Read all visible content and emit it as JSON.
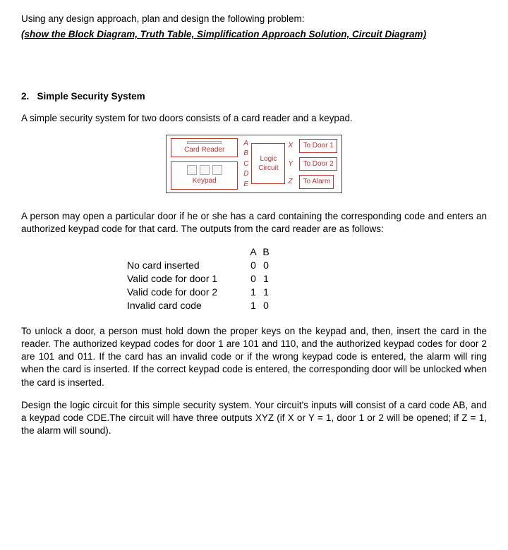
{
  "intro": {
    "line1": "Using any design approach,  plan and design the following problem:",
    "line2": "(show the Block Diagram, Truth Table, Simplification Approach Solution, Circuit Diagram)"
  },
  "section": {
    "number": "2.",
    "title": "Simple Security System",
    "intro": "A simple security system for two doors consists of a card reader and a keypad."
  },
  "block_diagram": {
    "card_reader": "Card Reader",
    "keypad": "Keypad",
    "signals_in": [
      "A",
      "B",
      "C",
      "D",
      "E"
    ],
    "logic_box_l1": "Logic",
    "logic_box_l2": "Circuit",
    "signals_out": [
      "X",
      "Y",
      "Z"
    ],
    "out_labels": [
      "To Door 1",
      "To Door 2",
      "To Alarm"
    ]
  },
  "para_after_diagram": "A person may open a particular door if he or she has a card containing the corresponding code and enters an authorized keypad code for that card. The outputs from the card reader are as follows:",
  "truth_table": {
    "header_a": "A",
    "header_b": "B",
    "rows": [
      {
        "label": "No card inserted",
        "a": "0",
        "b": "0"
      },
      {
        "label": "Valid code for door 1",
        "a": "0",
        "b": "1"
      },
      {
        "label": "Valid code for door 2",
        "a": "1",
        "b": "1"
      },
      {
        "label": "Invalid card code",
        "a": "1",
        "b": "0"
      }
    ]
  },
  "para_unlock": "To unlock a door, a person must hold down the proper keys on the keypad and, then, insert the card in the reader. The authorized keypad codes for door 1 are 101 and 110, and the authorized keypad codes for door 2 are 101 and 011. If the card has an invalid code or if the wrong keypad code is entered, the alarm will ring when the card is inserted. If the correct keypad code is entered, the corresponding door will be unlocked when the card is inserted.",
  "para_design": "Design the logic circuit for this simple security system. Your circuit's inputs will consist of a card code AB, and a keypad code CDE.The circuit will have three outputs XYZ (if X or Y = 1, door 1 or 2 will be opened; if Z = 1, the alarm will sound)."
}
